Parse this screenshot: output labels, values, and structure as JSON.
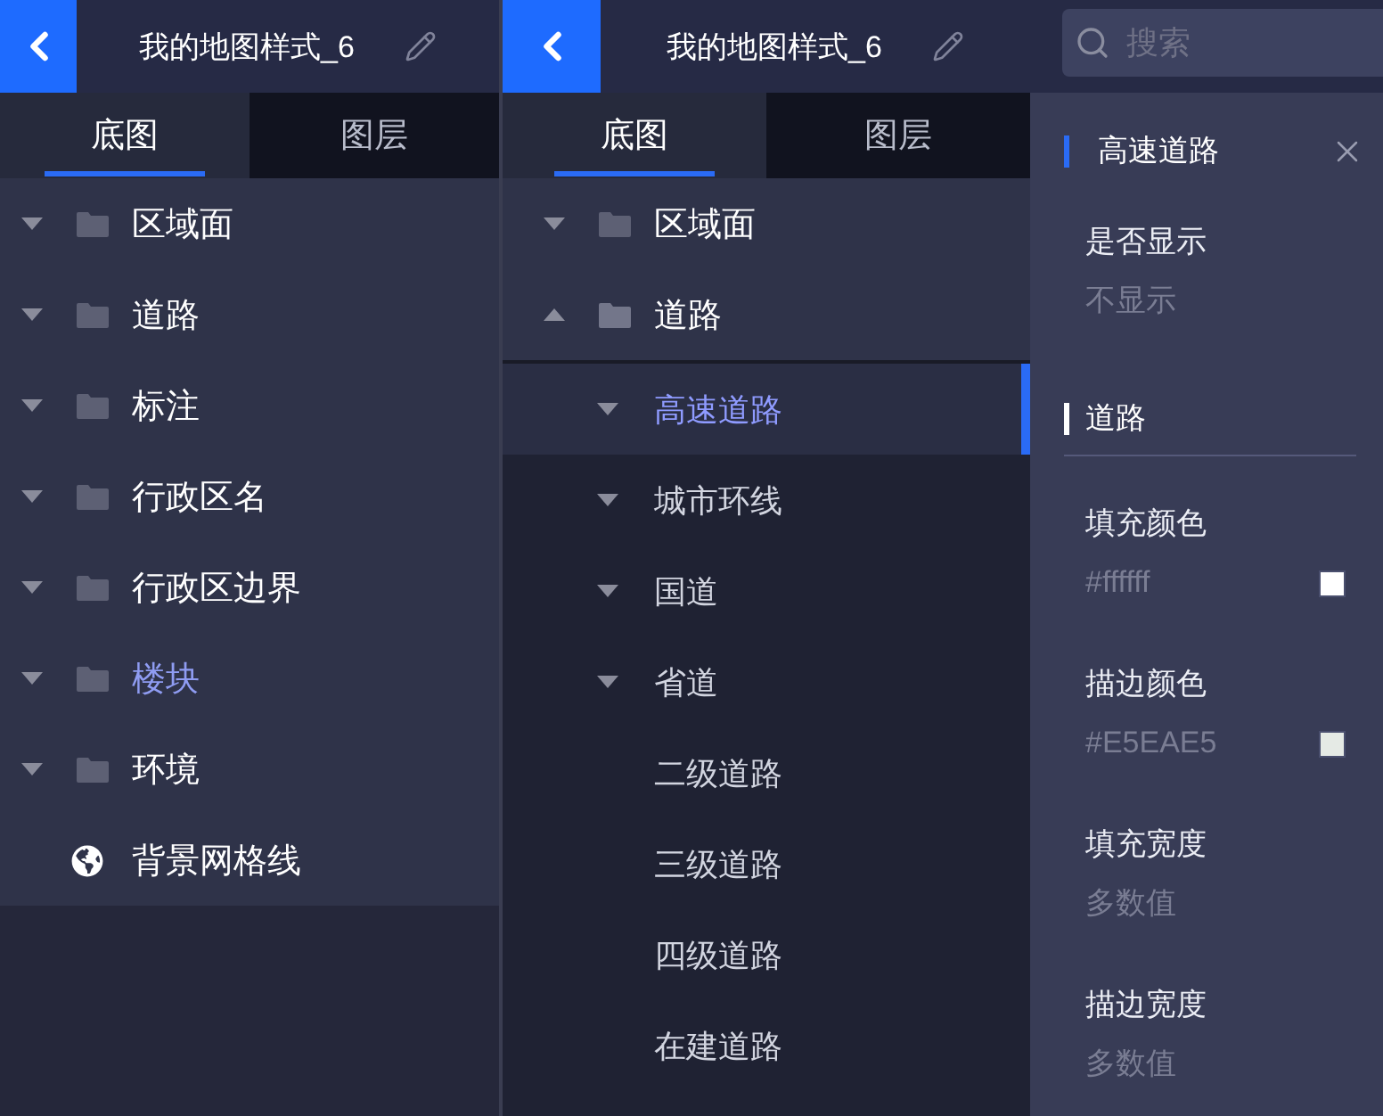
{
  "panels": [
    {
      "header": {
        "title": "我的地图样式_6"
      },
      "tabs": [
        {
          "label": "底图",
          "selected": true
        },
        {
          "label": "图层",
          "selected": false
        }
      ],
      "tree": [
        {
          "label": "区域面",
          "kind": "folder",
          "expanded": false,
          "highlighted": false
        },
        {
          "label": "道路",
          "kind": "folder",
          "expanded": false,
          "highlighted": false
        },
        {
          "label": "标注",
          "kind": "folder",
          "expanded": false,
          "highlighted": false
        },
        {
          "label": "行政区名",
          "kind": "folder",
          "expanded": false,
          "highlighted": false
        },
        {
          "label": "行政区边界",
          "kind": "folder",
          "expanded": false,
          "highlighted": false
        },
        {
          "label": "楼块",
          "kind": "folder",
          "expanded": false,
          "highlighted": true
        },
        {
          "label": "环境",
          "kind": "folder",
          "expanded": false,
          "highlighted": false
        },
        {
          "label": "背景网格线",
          "kind": "globe",
          "highlighted": false
        }
      ]
    },
    {
      "header": {
        "title": "我的地图样式_6"
      },
      "tabs": [
        {
          "label": "底图",
          "selected": true
        },
        {
          "label": "图层",
          "selected": false
        }
      ],
      "tree": [
        {
          "label": "区域面",
          "kind": "folder",
          "expanded": false,
          "highlighted": false
        },
        {
          "label": "道路",
          "kind": "folder",
          "expanded": true,
          "highlighted": false,
          "children": [
            {
              "label": "高速道路",
              "kind": "group",
              "expanded": false,
              "selected": true
            },
            {
              "label": "城市环线",
              "kind": "group",
              "expanded": false,
              "selected": false
            },
            {
              "label": "国道",
              "kind": "group",
              "expanded": false,
              "selected": false
            },
            {
              "label": "省道",
              "kind": "group",
              "expanded": false,
              "selected": false
            },
            {
              "label": "二级道路",
              "kind": "item",
              "selected": false
            },
            {
              "label": "三级道路",
              "kind": "item",
              "selected": false
            },
            {
              "label": "四级道路",
              "kind": "item",
              "selected": false
            },
            {
              "label": "在建道路",
              "kind": "item",
              "selected": false
            }
          ]
        }
      ]
    }
  ],
  "search": {
    "placeholder": "搜索"
  },
  "properties": {
    "title": "高速道路",
    "visibility": {
      "label": "是否显示",
      "value": "不显示"
    },
    "section": {
      "title": "道路",
      "fields": [
        {
          "kind": "color",
          "label": "填充颜色",
          "value": "#ffffff",
          "color": "#ffffff"
        },
        {
          "kind": "color",
          "label": "描边颜色",
          "value": "#E5EAE5",
          "color": "#e5eae5"
        },
        {
          "kind": "text",
          "label": "填充宽度",
          "value": "多数值"
        },
        {
          "kind": "text",
          "label": "描边宽度",
          "value": "多数值"
        }
      ]
    }
  }
}
